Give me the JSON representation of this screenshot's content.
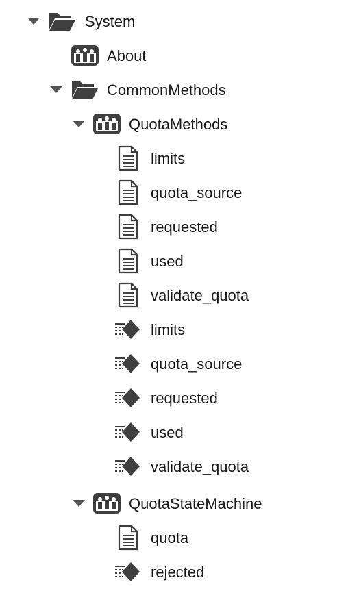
{
  "tree": {
    "system": {
      "label": "System",
      "icon": "folder-open-icon",
      "expanded": true
    },
    "about": {
      "label": "About",
      "icon": "class-instance-icon"
    },
    "common_methods": {
      "label": "CommonMethods",
      "icon": "folder-open-icon",
      "expanded": true
    },
    "quota_methods": {
      "label": "QuotaMethods",
      "icon": "class-instance-icon",
      "expanded": true,
      "children": [
        {
          "label": "limits",
          "icon": "document-icon"
        },
        {
          "label": "quota_source",
          "icon": "document-icon"
        },
        {
          "label": "requested",
          "icon": "document-icon"
        },
        {
          "label": "used",
          "icon": "document-icon"
        },
        {
          "label": "validate_quota",
          "icon": "document-icon"
        },
        {
          "label": "limits",
          "icon": "method-diamond-icon"
        },
        {
          "label": "quota_source",
          "icon": "method-diamond-icon"
        },
        {
          "label": "requested",
          "icon": "method-diamond-icon"
        },
        {
          "label": "used",
          "icon": "method-diamond-icon"
        },
        {
          "label": "validate_quota",
          "icon": "method-diamond-icon"
        }
      ]
    },
    "quota_state_machine": {
      "label": "QuotaStateMachine",
      "icon": "class-instance-icon",
      "expanded": true,
      "children": [
        {
          "label": "quota",
          "icon": "document-icon"
        },
        {
          "label": "rejected",
          "icon": "method-diamond-icon"
        }
      ]
    }
  },
  "colors": {
    "icon_dark": "#3f3f3f",
    "toggle": "#555555",
    "text": "#1a1a1a",
    "background": "#ffffff"
  }
}
